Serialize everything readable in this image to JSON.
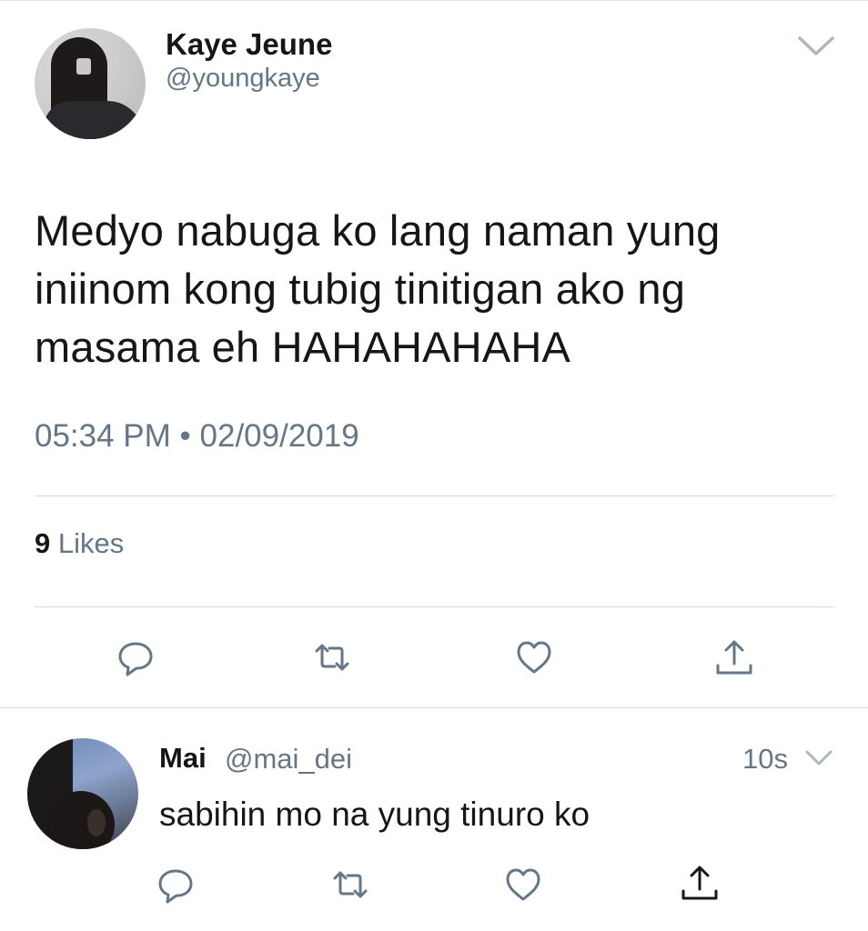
{
  "tweet": {
    "display_name": "Kaye Jeune",
    "handle": "@youngkaye",
    "text": "Medyo nabuga ko lang naman yung iniinom kong tubig tinitigan ako ng masama eh HAHAHAHAHA",
    "timestamp": "05:34 PM • 02/09/2019",
    "likes_count": "9",
    "likes_label": "Likes"
  },
  "reply": {
    "display_name": "Mai",
    "handle": "@mai_dei",
    "time": "10s",
    "text": "sabihin mo na yung tinuro ko"
  },
  "icons": {
    "actions": [
      "reply-icon",
      "retweet-icon",
      "like-icon",
      "share-icon"
    ],
    "menu": "chevron-down-icon"
  },
  "colors": {
    "text": "#14171a",
    "secondary": "#657786",
    "divider": "#e1e8ed",
    "icon": "#657786"
  }
}
